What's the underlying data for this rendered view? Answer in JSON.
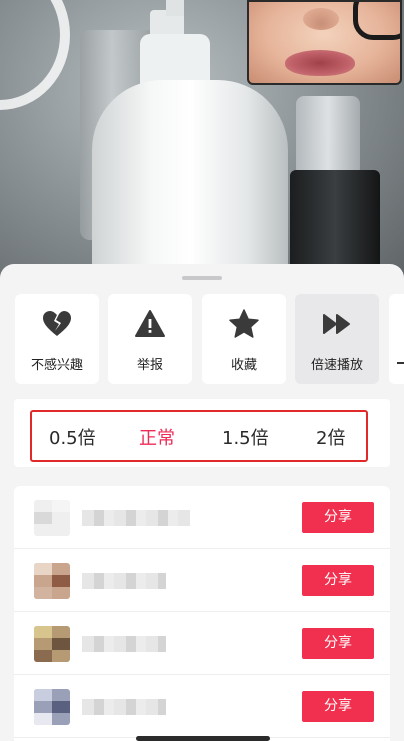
{
  "video": {
    "camera_overlay": "presenter-webcam"
  },
  "actions": [
    {
      "label": "不感兴趣",
      "icon": "broken-heart-icon"
    },
    {
      "label": "举报",
      "icon": "warning-icon"
    },
    {
      "label": "收藏",
      "icon": "star-icon"
    },
    {
      "label": "倍速播放",
      "icon": "fast-forward-icon",
      "active": true
    }
  ],
  "speed": {
    "options": [
      "0.5倍",
      "正常",
      "1.5倍",
      "2倍"
    ],
    "selected": "正常"
  },
  "share": {
    "button_label": "分享",
    "rows": [
      {
        "name_hidden": true
      },
      {
        "name_hidden": true
      },
      {
        "name_hidden": true
      },
      {
        "name_hidden": true
      }
    ]
  },
  "colors": {
    "accent": "#f1304f",
    "selected_text": "#ee2b57",
    "highlight_border": "#e02a2a"
  }
}
